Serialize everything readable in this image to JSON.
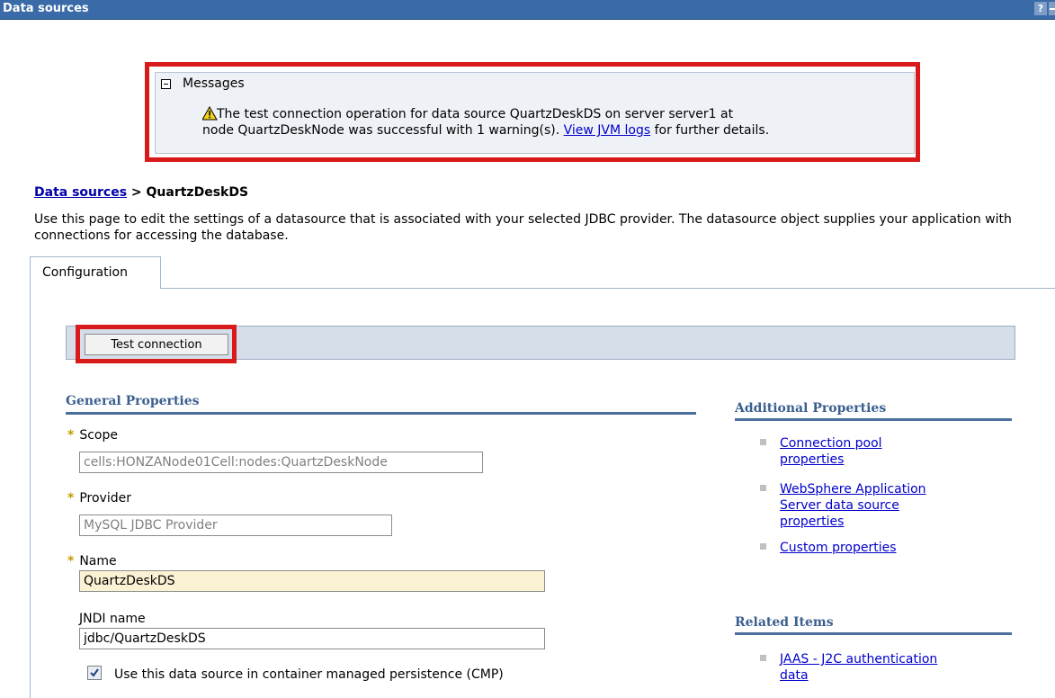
{
  "window": {
    "title": "Data sources",
    "help_label": "?"
  },
  "messages": {
    "title": "Messages",
    "line1": "The test connection operation for data source QuartzDeskDS on server server1 at",
    "line2_before": "node QuartzDeskNode was successful with 1 warning(s). ",
    "line2_link": "View JVM logs",
    "line2_after": " for further details."
  },
  "breadcrumb": {
    "parent": "Data sources",
    "separator": " > ",
    "current": "QuartzDeskDS"
  },
  "description": "Use this page to edit the settings of a datasource that is associated with your selected JDBC provider. The datasource object supplies your application with connections for accessing the database.",
  "tabs": [
    {
      "label": "Configuration"
    }
  ],
  "toolbar": {
    "test_connection_label": "Test connection"
  },
  "general_properties": {
    "heading": "General Properties",
    "required_marker": "*",
    "scope": {
      "label": "Scope",
      "value": "cells:HONZANode01Cell:nodes:QuartzDeskNode"
    },
    "provider": {
      "label": "Provider",
      "value": "MySQL JDBC Provider"
    },
    "name": {
      "label": "Name",
      "value": "QuartzDeskDS"
    },
    "jndi": {
      "label": "JNDI name",
      "value": "jdbc/QuartzDeskDS"
    },
    "cmp_checkbox": {
      "label": "Use this data source in container managed persistence (CMP)",
      "checked": true
    }
  },
  "additional_properties": {
    "heading": "Additional Properties",
    "items": [
      {
        "label_lines": [
          "Connection pool",
          "properties"
        ]
      },
      {
        "label_lines": [
          "WebSphere Application",
          "Server data source",
          "properties"
        ]
      },
      {
        "label_lines": [
          "Custom properties"
        ]
      }
    ]
  },
  "related_items": {
    "heading": "Related Items",
    "items": [
      {
        "label_lines": [
          "JAAS - J2C authentication",
          "data"
        ]
      }
    ]
  },
  "colors": {
    "titlebar": "#3a6aa8",
    "highlight": "#d81a1a",
    "link": "#0000cc",
    "section_heading": "#3a5f8f"
  }
}
